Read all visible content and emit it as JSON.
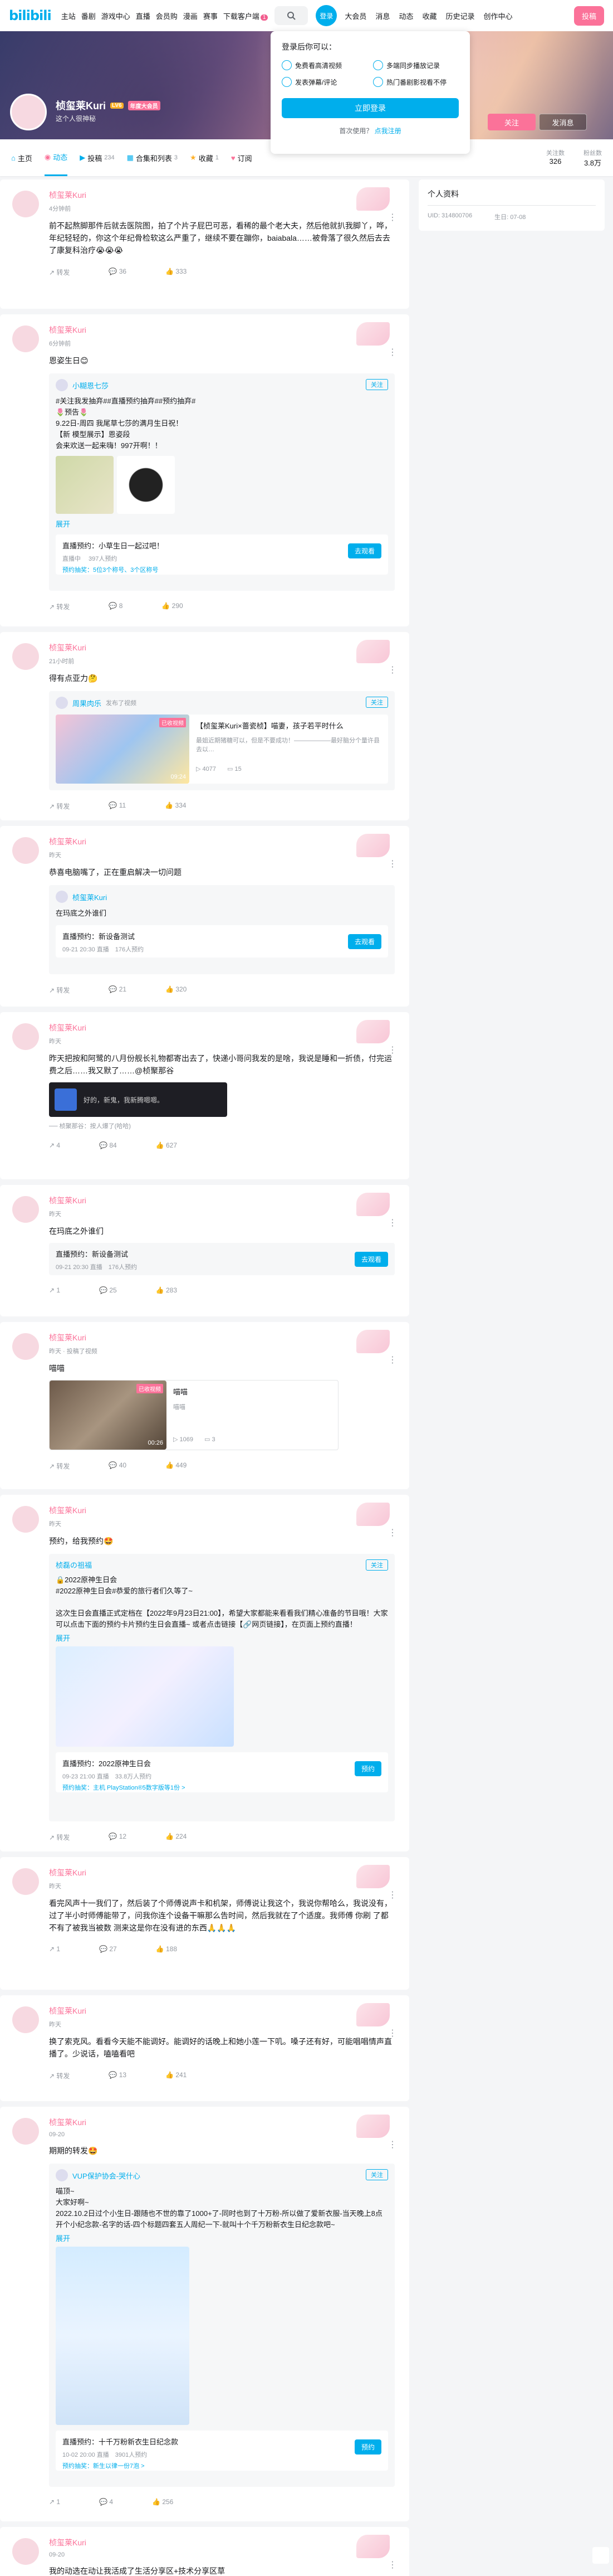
{
  "topnav": {
    "left": [
      "主站",
      "番剧",
      "游戏中心",
      "直播",
      "会员购",
      "漫画",
      "赛事",
      "下载客户端"
    ],
    "download_badge": "1",
    "search_icon": "search-icon",
    "avatar_label": "登录",
    "right": [
      "大会员",
      "消息",
      "动态",
      "收藏",
      "历史记录",
      "创作中心"
    ],
    "upload": "投稿"
  },
  "login_popover": {
    "title": "登录后你可以：",
    "items": [
      "免费看高清视频",
      "多端同步播放记录",
      "发表弹幕/评论",
      "热门番剧影视看不停"
    ],
    "login_button": "立即登录",
    "register_prompt": "首次使用？",
    "register_link": "点我注册"
  },
  "profile": {
    "name": "桢玺莱Kuri",
    "level": "LV6",
    "vip": "年度大会员",
    "sign": "这个人很神秘",
    "follow_button": "关注",
    "message_button": "发消息"
  },
  "tabs": [
    {
      "label": "主页",
      "count": ""
    },
    {
      "label": "动态",
      "count": ""
    },
    {
      "label": "投稿",
      "count": "234"
    },
    {
      "label": "合集和列表",
      "count": "3"
    },
    {
      "label": "收藏",
      "count": "1"
    },
    {
      "label": "订阅",
      "count": ""
    }
  ],
  "stats": {
    "following_label": "关注数",
    "following": "326",
    "fans_label": "粉丝数",
    "fans": "3.8万"
  },
  "sidebar": {
    "title": "个人资料",
    "uid": "UID: 314800706",
    "birthday": "生日: 07-08"
  },
  "posts": [
    {
      "name": "桢玺莱Kuri",
      "time": "4分钟前",
      "text": "前不起熬脚那件后就去医院图，拍了个片子屁巴可恶，看稀的最个老大夫，然后他就扒我脚丫，哗，年纪轻轻的，你这个年纪骨检软这么严重了，继续不要在蹦你，baiabala……被骨落了很久然后去去了康复科治疗😭😭😭",
      "forward": "转发",
      "comment": "36",
      "like": "333"
    },
    {
      "name": "桢玺莱Kuri",
      "time": "6分钟前",
      "text": "恩姿生日😊",
      "fwd_name": "小糊恩七莎",
      "fwd_follow": "关注",
      "fwd_text": "#关注我发抽弃##直播预约抽弃##预约抽弃#\n🌷预告🌷\n9.22日-周四 我尾草七莎的满月生日祝！\n【新 模型展示】恩姿段\n会来欢送一起来嗨！997开啊！！",
      "expand": "展开",
      "rsv_title": "直播预约：小草生日一起过吧！",
      "rsv_meta": "直播中 　397人预约",
      "rsv_btn": "去观看",
      "rsv_sub": "预约抽奖：5位3个称号、3个区称号",
      "forward": "转发",
      "comment": "8",
      "like": "290"
    },
    {
      "name": "桢玺莱Kuri",
      "time": "21小时前",
      "text": "得有点亚力🤔",
      "fwd_name": "周果肉乐",
      "fwd_sub": "发布了视频",
      "fwd_follow": "关注",
      "video_title": "【桢玺莱Kuri×蔷瓷桢】喵妻，孩子若平时什么",
      "video_desc": "最姐近期猪糖可以，但是不要成功！——————最好脑分个量许县去以…",
      "video_duration": "09:24",
      "video_badge": "已收视频",
      "video_play": "4077",
      "video_danmaku": "15",
      "forward": "转发",
      "comment": "11",
      "like": "334"
    },
    {
      "name": "桢玺莱Kuri",
      "time": "昨天",
      "text": "恭喜电脑嘴了，正在重启解决一切问题",
      "fwd_name": "桢玺莱Kuri",
      "fwd_text": "在玛底之外谁们",
      "rsv_title": "直播预约：新设备测试",
      "rsv_meta": "09-21 20:30 直播　176人预约",
      "rsv_btn": "去观看",
      "forward": "转发",
      "comment": "21",
      "like": "320"
    },
    {
      "name": "桢玺莱Kuri",
      "time": "昨天",
      "text": "昨天把按和阿鹭的八月份舰长礼物都寄出去了，快递小哥问我发的是啥，我说是睡和一折债，付完运费之后……我又默了……@桢聚那谷",
      "dark_text": "好的，新鬼，我新腾嗯嗯。",
      "reply": "── 桢聚那谷：按人爆了(哈哈)",
      "forward": "4",
      "comment": "84",
      "like": "627"
    },
    {
      "name": "桢玺莱Kuri",
      "time": "昨天",
      "text": "在玛底之外谁们",
      "rsv_title": "直播预约：新设备测试",
      "rsv_meta": "09-21 20:30 直播　176人预约",
      "rsv_btn": "去观看",
      "forward": "1",
      "comment": "25",
      "like": "283"
    },
    {
      "name": "桢玺莱Kuri",
      "time": "昨天 · 投稿了视频",
      "text": "喵喵",
      "video_title": "喵喵",
      "video_desc": "喵喵",
      "video_duration": "00:26",
      "video_badge": "已收视频",
      "video_play": "1069",
      "video_danmaku": "3",
      "forward": "转发",
      "comment": "40",
      "like": "449"
    },
    {
      "name": "桢玺莱Kuri",
      "time": "昨天",
      "text": "预约，给我预约🤩",
      "fwd_name": "桢磊の祖福",
      "fwd_follow": "关注",
      "fwd_text": "🔒2022原神生日会\n#2022原神生日会#恭爱的旅行者们久等了~\n\n这次生日会直播正式定档在【2022年9月23日21:00】，希望大家都能来看看我们精心准备的节目哦！大家可以点击下面的预约卡片预约生日会直播~ 或者点击链接【🔗网页链接】，在页面上预约直播！",
      "expand": "展开",
      "rsv_title": "直播预约：2022原神生日会",
      "rsv_meta": "09-23 21:00 直播　33.8万人预约",
      "rsv_btn": "预约",
      "rsv_sub": "预约抽奖：主机 PlayStation®5数字版等1份 >",
      "forward": "转发",
      "comment": "12",
      "like": "224"
    },
    {
      "name": "桢玺莱Kuri",
      "time": "昨天",
      "text": "看完风声十一我们了，然后装了个师傅说声卡和机架，师傅说让我这个，我说你帮哈么，我说没有，过了半小时师傅能带了，问我你连个设备干嘛那么告时间，然后我就在了个适度。我师傅 你刷 了都不有了被我当被数 测来这是你在没有进的东西🙏🙏🙏",
      "forward": "1",
      "comment": "27",
      "like": "188"
    },
    {
      "name": "桢玺莱Kuri",
      "time": "昨天",
      "text": "换了索克风。看看今天能不能调好。能调好的话晚上和她小莲一下叽。嗓子还有好，可能唱唱情声直播了。少说话，嗑嗑看吧",
      "forward": "转发",
      "comment": "13",
      "like": "241"
    },
    {
      "name": "桢玺莱Kuri",
      "time": "09-20",
      "text": "期期的转发🤩",
      "fwd_name": "VUP保护协会-哭什心",
      "fwd_follow": "关注",
      "fwd_text": "喵顶~\n大家好啊~\n2022.10.2日过个小生日-跟随也不世的靠了1000+了-同时也到了十万粉-所以做了爱新衣服-当天晚上8点开个小纪念款-名字的话-四个标题四套五人周纪一下-就叫十个千万粉新衣生日纪念款吧~",
      "expand": "展开",
      "rsv_title": "直播预约：十千万粉新衣生日纪念款",
      "rsv_meta": "10-02 20:00 直播　3901人预约",
      "rsv_btn": "预约",
      "rsv_sub": "预约抽奖：新生以律一份7泡 >",
      "forward": "1",
      "comment": "4",
      "like": "256"
    },
    {
      "name": "桢玺莱Kuri",
      "time": "09-20",
      "text": "我的动选在动让我活成了生活分享区+技术分享区草",
      "forward": "2",
      "comment": "30",
      "like": "505"
    }
  ],
  "colors": {
    "accent": "#00aeec",
    "pink": "#fb7299",
    "bg": "#f4f5f7"
  }
}
